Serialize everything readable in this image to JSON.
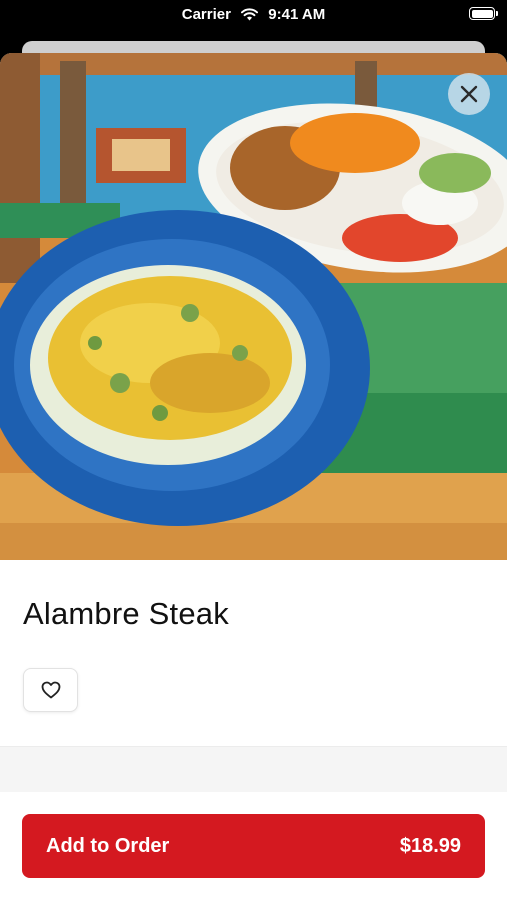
{
  "status_bar": {
    "carrier": "Carrier",
    "time": "9:41 AM",
    "wifi_icon": "wifi-icon",
    "battery_icon": "battery-icon"
  },
  "item": {
    "title": "Alambre Steak",
    "image_icon": "food-photo",
    "close_icon": "close-icon",
    "favorite_icon": "heart-icon"
  },
  "footer": {
    "add_label": "Add to Order",
    "price": "$18.99"
  },
  "colors": {
    "accent": "#d41920",
    "close_button": "#cde1eb"
  }
}
